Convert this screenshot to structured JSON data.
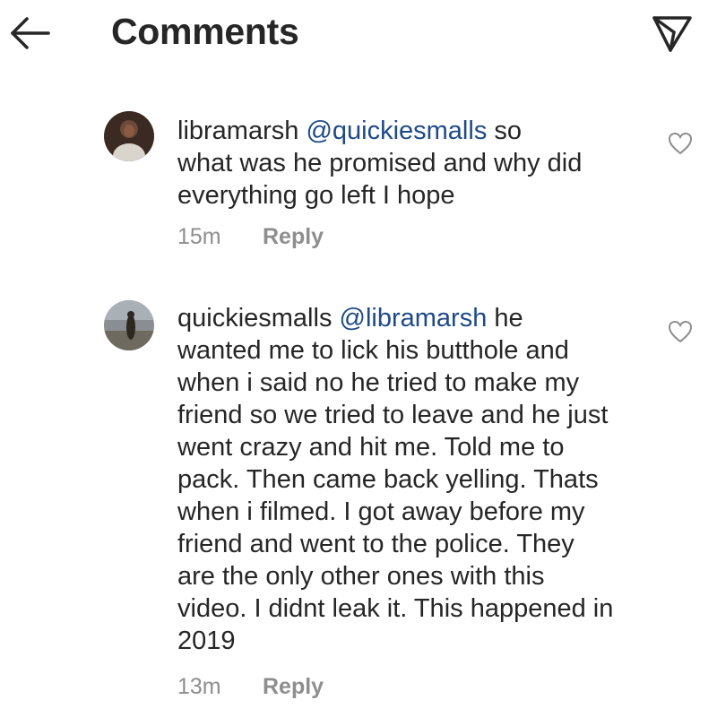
{
  "header": {
    "title": "Comments",
    "back_icon": "arrow-left-icon",
    "share_icon": "send-icon"
  },
  "comments": [
    {
      "username": "libramarsh",
      "mention": "@quickiesmalls",
      "lines": [
        "so",
        "what was he promised and why did",
        "everything go left I hope"
      ],
      "time": "15m",
      "reply": "Reply",
      "like_icon": "heart-icon"
    },
    {
      "username": "quickiesmalls",
      "mention": "@libramarsh",
      "lines": [
        "he",
        "wanted me to lick his butthole and",
        "when i said no he tried to make my",
        "friend so we tried to leave and he just",
        "went crazy and hit me. Told me to",
        "pack. Then came back yelling. Thats",
        "when i filmed. I got away before my",
        "friend and went to the police. They",
        "are the only other ones with this",
        "video. I didnt leak it. This happened in",
        "2019"
      ],
      "time": "13m",
      "reply": "Reply",
      "like_icon": "heart-icon"
    }
  ]
}
